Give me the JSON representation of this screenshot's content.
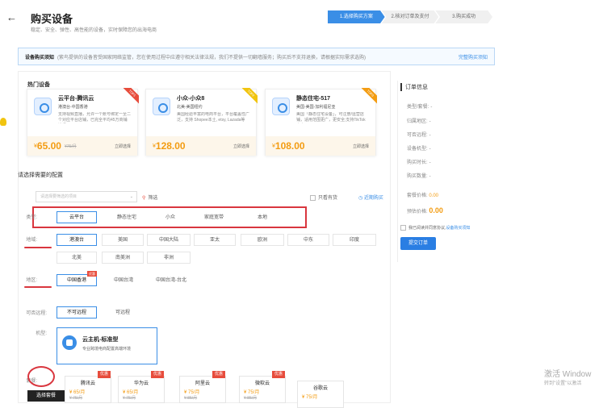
{
  "header": {
    "back": "←",
    "title": "购买设备",
    "subtitle": "稳定、安全、弹性、高性能的设备，实时保障您的出海电商",
    "steps": [
      "1.选择购买方案",
      "2.核对订单及支付",
      "3.购买成功"
    ]
  },
  "notice": {
    "label": "设备购买须知",
    "text": "(紫鸟提供的设备皆受国家网络监管，您在使用过程中应遵守相关法律法规，我们不提供一切翻墙服务；购买后不支持退换，请根据实际需求选购)",
    "link": "完整购买须知"
  },
  "hot": {
    "title": "热门设备",
    "cards": [
      {
        "name": "云平台-腾讯云",
        "tag": "港澳台-中国香港",
        "desc": "支持视频直播，允许一个账号绑定一至二个对应平台店铺，已完全平均45万商铺选择",
        "currency": "¥",
        "price": "65.00",
        "old": "¥75/月",
        "buy": "立即选择",
        "ribbon": "TOP1"
      },
      {
        "name": "小众-小众8",
        "tag": "北美-美国纽约",
        "desc": "美国经验丰富的电商平台，平台覆盖性广泛，支持 Shopee本土, etsy, Lazada等",
        "currency": "¥",
        "price": "128.00",
        "old": "",
        "buy": "立即选择",
        "ribbon": "TOP2"
      },
      {
        "name": "静态住宅-517",
        "tag": "美国-美国-加利福尼亚",
        "desc": "美国「静态住宅设备」，可注册/运营店铺，适用范围更广，更安全;支持TikTok本土",
        "currency": "¥",
        "price": "108.00",
        "old": "",
        "buy": "立即选择",
        "ribbon": "TOP3"
      }
    ]
  },
  "config": {
    "title": "请选择需要的配置",
    "search_placeholder": "请选择要筛选的项目",
    "filter": "筛选",
    "only_label": "只看有货",
    "recent": "近期购买",
    "type_label": "类型:",
    "types": [
      "云平台",
      "静态住宅",
      "小众",
      "家庭宽带",
      "本地"
    ],
    "region_label": "地域:",
    "regions": [
      "港澳台",
      "美国",
      "中国大陆",
      "亚太",
      "欧洲",
      "中东",
      "印度",
      "北美",
      "南美洲",
      "非洲"
    ],
    "area_label": "地区:",
    "areas": [
      "中国香港",
      "中国台湾",
      "中国台湾-台北"
    ],
    "area_badge": "优惠",
    "remote_label": "可否远程:",
    "remotes": [
      "不可远程",
      "可远程"
    ],
    "model_label": "机型:",
    "model_name": "云主机-标准型",
    "model_desc": "专业跨境电商配置高端环境",
    "supplier_label": "套餐:",
    "suppliers": [
      {
        "name": "腾讯云",
        "price": "¥ 65/月",
        "old": "¥ 75/月",
        "badge": "优惠"
      },
      {
        "name": "华为云",
        "price": "¥ 65/月",
        "old": "¥ 75/月",
        "badge": "优惠"
      },
      {
        "name": "阿里云",
        "price": "¥ 75/月",
        "old": "¥ 85/月",
        "badge": "优惠"
      },
      {
        "name": "微软云",
        "price": "¥ 75/月",
        "old": "¥ 85/月",
        "badge": "优惠"
      },
      {
        "name": "谷歌云",
        "price": "¥ 75/月",
        "old": "",
        "badge": ""
      }
    ],
    "tooltip": "选择套餐"
  },
  "order": {
    "title": "订单信息",
    "rows": [
      {
        "k": "类型/套餐:",
        "v": "-"
      },
      {
        "k": "归属地区:",
        "v": "-"
      },
      {
        "k": "可否远程:",
        "v": "-"
      },
      {
        "k": "设备机型:",
        "v": "-"
      },
      {
        "k": "购买时长:",
        "v": "-"
      },
      {
        "k": "购买数量:",
        "v": "-"
      }
    ],
    "fee_label": "套餐价格:",
    "fee_value": "0.00",
    "pay_label": "预估价格:",
    "pay_value": "0.00",
    "agree_text": "我已阅读并同意协议,",
    "agree_link": "设备购买须知",
    "submit": "提交订单"
  },
  "watermark": {
    "line1": "激活 Window",
    "line2": "转到\"设置\"以激活"
  }
}
